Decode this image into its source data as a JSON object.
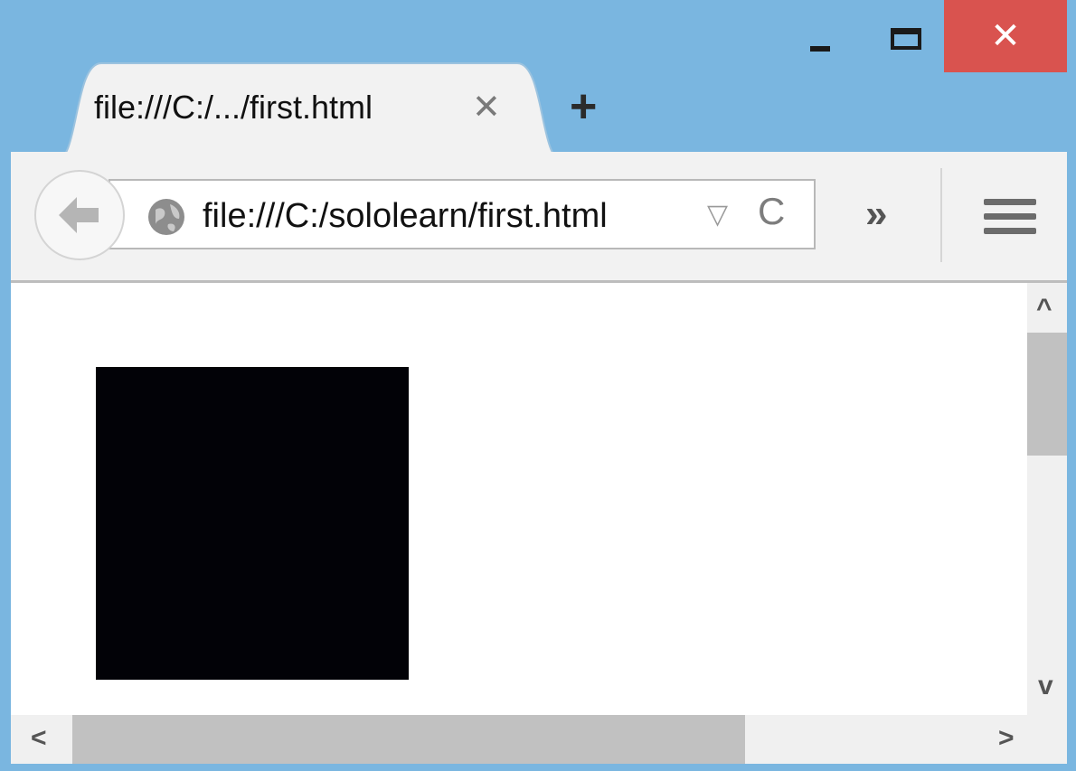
{
  "window": {
    "minimize_icon": "minimize-icon",
    "maximize_icon": "maximize-icon",
    "close_glyph": "✕"
  },
  "tab": {
    "title": "file:///C:/.../first.html",
    "close_glyph": "✕"
  },
  "new_tab_glyph": "+",
  "toolbar": {
    "url": "file:///C:/sololearn/first.html",
    "dropdown_glyph": "▽",
    "reload_glyph": "C",
    "overflow_glyph": "»"
  },
  "scrollbars": {
    "up": "^",
    "down": "v",
    "left": "<",
    "right": ">"
  },
  "colors": {
    "titlebar": "#7ab6e0",
    "close_button": "#d9534f",
    "content_box": "#020207"
  }
}
